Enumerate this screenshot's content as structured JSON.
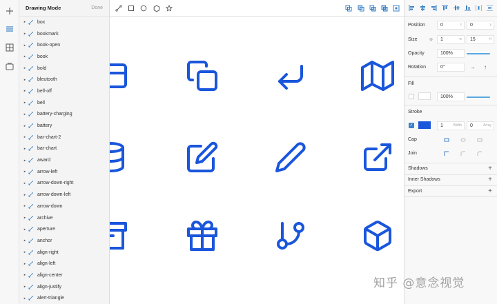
{
  "layers_panel": {
    "title": "Drawing Mode",
    "done_label": "Done",
    "items": [
      {
        "label": "box"
      },
      {
        "label": "bookmark"
      },
      {
        "label": "book-open"
      },
      {
        "label": "book"
      },
      {
        "label": "bold"
      },
      {
        "label": "bleutooth"
      },
      {
        "label": "bell-off"
      },
      {
        "label": "bell"
      },
      {
        "label": "battery-charging"
      },
      {
        "label": "battery"
      },
      {
        "label": "bar-chart-2"
      },
      {
        "label": "bar-chart"
      },
      {
        "label": "award"
      },
      {
        "label": "arrow-left"
      },
      {
        "label": "arrow-down-right"
      },
      {
        "label": "arrow-down-left"
      },
      {
        "label": "arrow-down"
      },
      {
        "label": "archive"
      },
      {
        "label": "aperture"
      },
      {
        "label": "anchor"
      },
      {
        "label": "align-right"
      },
      {
        "label": "align-left"
      },
      {
        "label": "align-center"
      },
      {
        "label": "align-justify"
      },
      {
        "label": "alert-triangle"
      }
    ]
  },
  "rail": {
    "icons": [
      "plus-icon",
      "list-icon",
      "grid-icon",
      "briefcase-icon"
    ]
  },
  "toolbar": {
    "tools": [
      "line-tool-icon",
      "rectangle-tool-icon",
      "oval-tool-icon",
      "polygon-tool-icon",
      "star-tool-icon"
    ],
    "boolean_ops": [
      "union-icon",
      "subtract-icon",
      "intersect-icon",
      "difference-icon",
      "flatten-icon"
    ]
  },
  "canvas": {
    "accent_color": "#1a56db",
    "icons": [
      "credit-card-icon",
      "copy-icon",
      "corner-down-left-icon",
      "map-icon",
      "database-icon",
      "edit-icon",
      "edit-2-icon",
      "external-link-icon",
      "archive-icon",
      "gift-icon",
      "git-branch-icon",
      "box-icon"
    ]
  },
  "inspector": {
    "position": {
      "label": "Position",
      "x": "0",
      "x_unit": "x",
      "y": "0",
      "y_unit": "y"
    },
    "size": {
      "label": "Size",
      "w": "1",
      "w_unit": "w",
      "h": "15",
      "h_unit": "H"
    },
    "opacity": {
      "label": "Opacity",
      "value": "100%"
    },
    "rotation": {
      "label": "Rotation",
      "value": "0°"
    },
    "fill": {
      "label": "Fill",
      "opacity": "100%"
    },
    "stroke": {
      "label": "Stroke",
      "width": "1",
      "width_unit": "Width",
      "array": "0",
      "array_unit": "Array",
      "color": "#1a56db"
    },
    "cap": {
      "label": "Cap"
    },
    "join": {
      "label": "Join"
    },
    "shadows": {
      "label": "Shadows"
    },
    "inner_shadows": {
      "label": "Inner Shadows"
    },
    "export": {
      "label": "Export"
    }
  },
  "watermark": "知乎 @意念视觉"
}
